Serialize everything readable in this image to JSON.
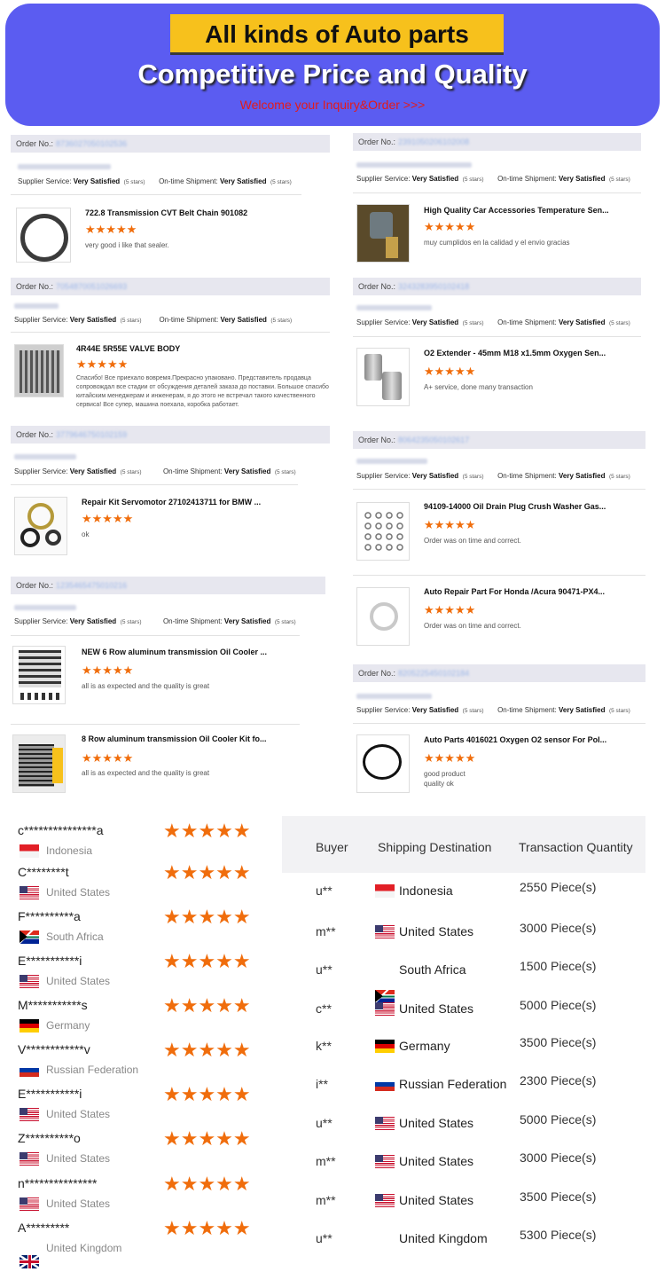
{
  "banner": {
    "title": "All kinds of Auto parts",
    "subtitle": "Competitive Price and Quality",
    "cta": "Welcome your Inquiry&Order >>>"
  },
  "labels": {
    "order_no": "Order No.:",
    "supplier_service": "Supplier Service:",
    "ontime_shipment": "On-time Shipment:",
    "very_satisfied": "Very Satisfied",
    "five_stars": "(5 stars)",
    "stars": "★★★★★"
  },
  "orders_left": [
    {
      "order_no": "8736027050102536",
      "title": "722.8 Transmission CVT Belt Chain 901082",
      "feedback": "very good i like that sealer."
    },
    {
      "order_no": "7054870051026693",
      "title": "4R44E 5R55E VALVE BODY",
      "feedback": "Спасибо! Все приехало вовремя.Прекрасно упаковано. Представитель продавца сопровождал все стадии от обсуждения деталей заказа до поставки. Большое спасибо китайским менеджерам и инженерам, я до этого не встречал такого качественного сервиса! Все супер, машина поехала, коробка работает."
    },
    {
      "order_no": "3779646750102159",
      "title": "Repair Kit Servomotor 27102413711 for BMW ...",
      "feedback": "ok"
    },
    {
      "order_no": "1235465475010216",
      "title": "NEW 6 Row aluminum transmission Oil Cooler ...",
      "feedback": "all is as expected and the quality is great"
    },
    {
      "title": "8 Row aluminum transmission Oil Cooler Kit fo...",
      "feedback": "all is as expected and the quality is great"
    }
  ],
  "orders_right": [
    {
      "order_no": "2391050206102008",
      "title": "High Quality Car Accessories Temperature Sen...",
      "feedback": "muy cumplidos en la calidad y el envio gracias"
    },
    {
      "order_no": "3243283950102418",
      "title": "O2 Extender - 45mm M18 x1.5mm Oxygen Sen...",
      "feedback": "A+ service,   done many transaction"
    },
    {
      "order_no": "8064235050102617",
      "title": "94109-14000 Oil Drain Plug Crush Washer Gas...",
      "feedback": "Order was on time and correct."
    },
    {
      "title": "Auto Repair Part For Honda /Acura 90471-PX4...",
      "feedback": "Order was on time and correct."
    },
    {
      "order_no": "8205225450102184",
      "title": "Auto Parts 4016021 Oxygen O2 sensor For Pol...",
      "feedback": "good product\nquality ok"
    }
  ],
  "buyers": [
    {
      "name": "c***************a",
      "country": "Indonesia",
      "flag": "id"
    },
    {
      "name": "C********t",
      "country": "United States",
      "flag": "us"
    },
    {
      "name": "F**********a",
      "country": "South Africa",
      "flag": "za"
    },
    {
      "name": "E***********i",
      "country": "United States",
      "flag": "us"
    },
    {
      "name": "M***********s",
      "country": "Germany",
      "flag": "de"
    },
    {
      "name": "V************v",
      "country": "Russian Federation",
      "flag": "ru"
    },
    {
      "name": "E***********i",
      "country": "United States",
      "flag": "us"
    },
    {
      "name": "Z**********o",
      "country": "United States",
      "flag": "us"
    },
    {
      "name": "n***************",
      "country": "United States",
      "flag": "us"
    },
    {
      "name": "A*********",
      "country": "United Kingdom",
      "flag": "gb"
    }
  ],
  "transactions": {
    "headers": [
      "Buyer",
      "Shipping Destination",
      "Transaction Quantity"
    ],
    "rows": [
      {
        "buyer": "u**",
        "destination": "Indonesia",
        "flag": "id",
        "quantity": "2550 Piece(s)"
      },
      {
        "buyer": "m**",
        "destination": "United States",
        "flag": "us",
        "quantity": "3000 Piece(s)"
      },
      {
        "buyer": "u**",
        "destination": "South Africa",
        "flag": "za",
        "quantity": "1500 Piece(s)"
      },
      {
        "buyer": "c**",
        "destination": "United States",
        "flag": "us",
        "quantity": "5000 Piece(s)"
      },
      {
        "buyer": "k**",
        "destination": "Germany",
        "flag": "de",
        "quantity": "3500 Piece(s)"
      },
      {
        "buyer": "i**",
        "destination": "Russian Federation",
        "flag": "ru",
        "quantity": "2300 Piece(s)"
      },
      {
        "buyer": "u**",
        "destination": "United States",
        "flag": "us",
        "quantity": "5000 Piece(s)"
      },
      {
        "buyer": "m**",
        "destination": "United States",
        "flag": "us",
        "quantity": "3000 Piece(s)"
      },
      {
        "buyer": "m**",
        "destination": "United States",
        "flag": "us",
        "quantity": "3500 Piece(s)"
      },
      {
        "buyer": "u**",
        "destination": "United Kingdom",
        "flag": "gb",
        "quantity": "5300 Piece(s)"
      }
    ]
  },
  "colors": {
    "banner": "#5b5cf1",
    "title_box": "#f7c11c",
    "cta": "#e31b1b",
    "stars": "#f06d0c"
  }
}
